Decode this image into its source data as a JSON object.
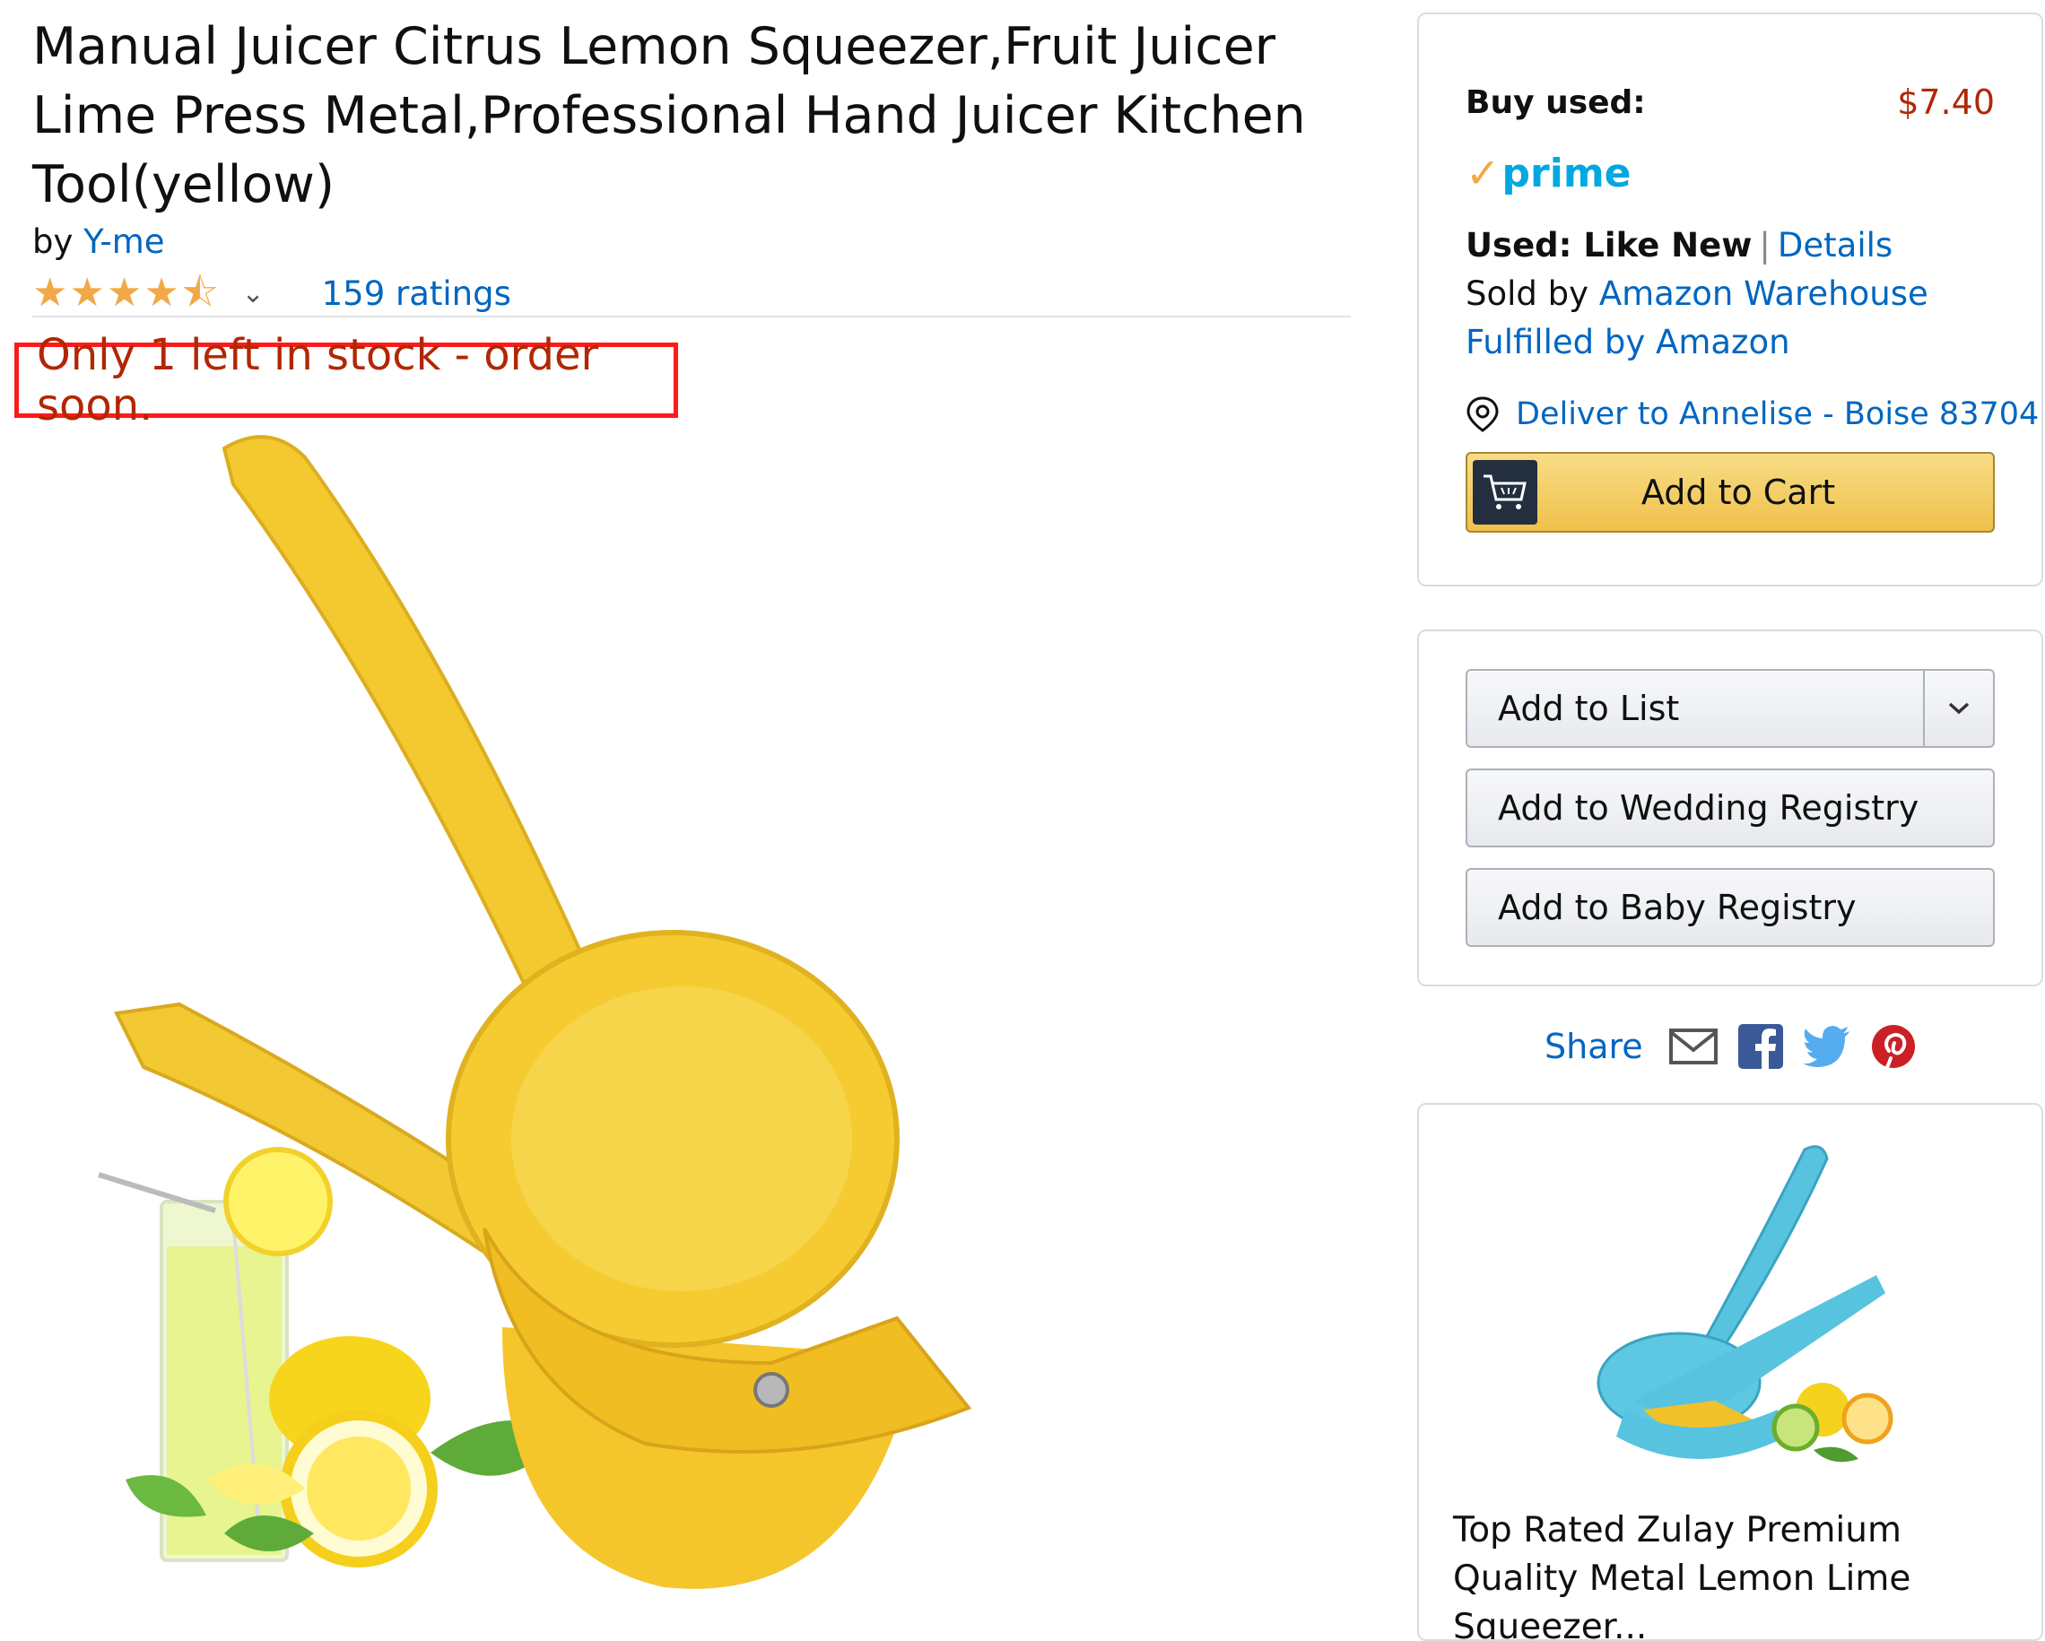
{
  "product": {
    "title": "Manual Juicer Citrus Lemon Squeezer,Fruit Juicer Lime Press Metal,Professional Hand Juicer Kitchen Tool(yellow)",
    "by_prefix": "by",
    "brand": "Y-me",
    "rating": 4.5,
    "ratings_count": "159 ratings",
    "stock_message": "Only 1 left in stock - order soon."
  },
  "buybox": {
    "buy_label": "Buy used:",
    "price": "$7.40",
    "prime_label": "prime",
    "condition_label": "Used: Like New",
    "details_link": "Details",
    "sold_by_prefix": "Sold by",
    "seller": "Amazon Warehouse",
    "fulfilled": "Fulfilled by Amazon",
    "deliver_to": "Deliver to Annelise - Boise 83704",
    "add_to_cart": "Add to Cart"
  },
  "lists": {
    "add_to_list": "Add to List",
    "wedding": "Add to Wedding Registry",
    "baby": "Add to Baby Registry"
  },
  "share": {
    "label": "Share",
    "icons": [
      "email-icon",
      "facebook-icon",
      "twitter-icon",
      "pinterest-icon"
    ]
  },
  "recommendation": {
    "title": "Top Rated Zulay Premium Quality Metal Lemon Lime Squeezer..."
  },
  "colors": {
    "link": "#0066c0",
    "price": "#b12704",
    "stock": "#b12704",
    "highlight_box": "#ff1a1a",
    "cart_button": "#f0c14b",
    "prime": "#00a8e1",
    "star": "#f3a847"
  }
}
